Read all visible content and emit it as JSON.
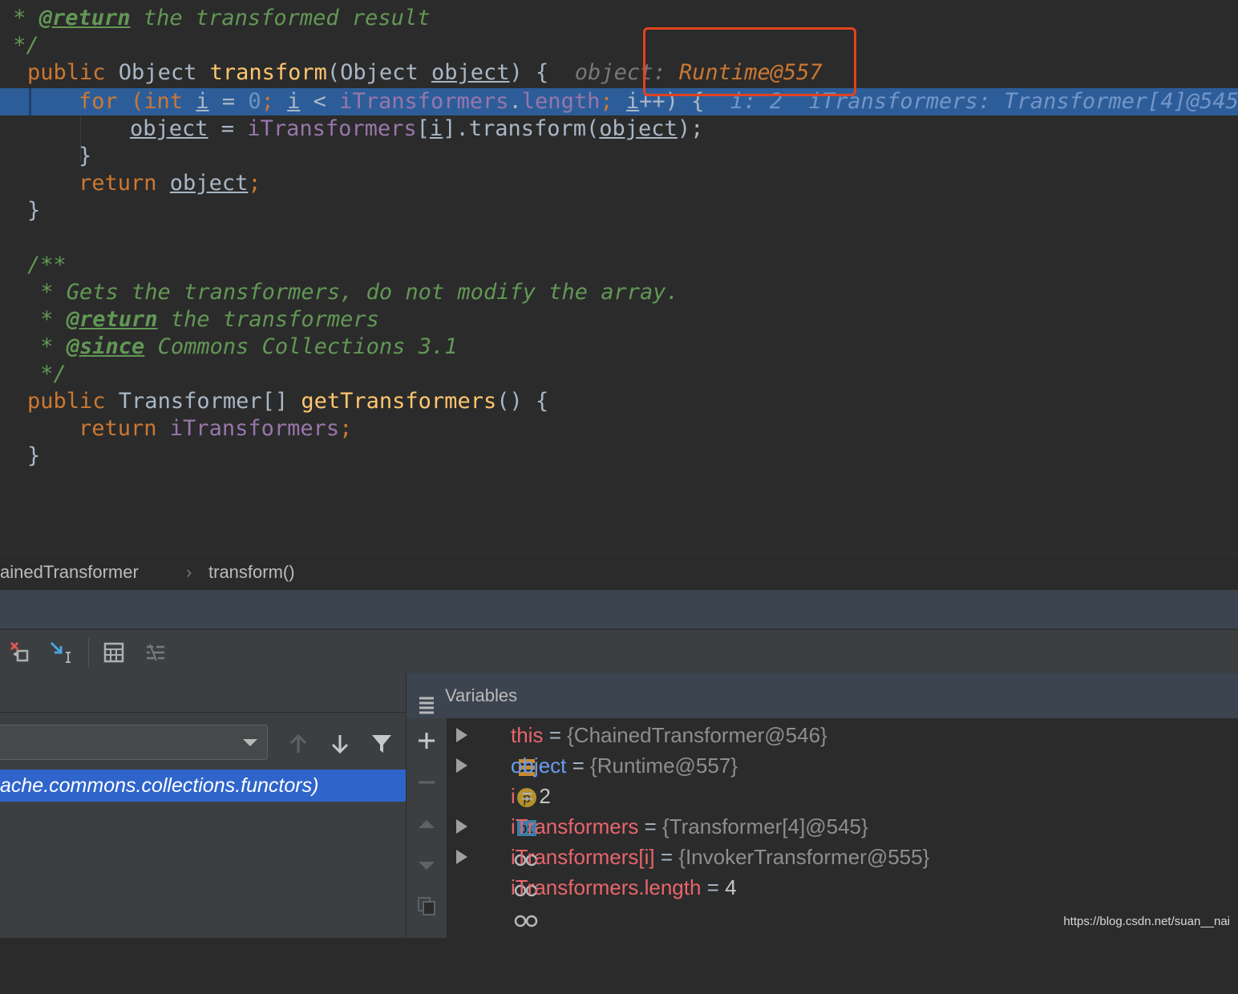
{
  "editor": {
    "line1": {
      "star": " * ",
      "tag": "@return",
      "rest": " the transformed result"
    },
    "line2": " */",
    "line3": {
      "kw": "public ",
      "type": "Object ",
      "fn": "transform",
      "p1": "(Object ",
      "param": "object",
      "p2": ") {",
      "hint_label": "object: ",
      "hint_value": "Runtime@557"
    },
    "line4": {
      "kw": "for ",
      "p1": "(",
      "kw2": "int ",
      "var": "i",
      "p2": " = ",
      "num": "0",
      "semi": "; ",
      "var2": "i",
      "p3": " < ",
      "fld": "iTransformers",
      "dot": ".",
      "fld2": "length",
      "semi2": "; ",
      "var3": "i",
      "p4": "++) {",
      "hint1": "i: 2",
      "hint2": "iTransformers: Transformer[4]@545"
    },
    "line5": {
      "var": "object",
      "p1": " = ",
      "fld": "iTransformers",
      "p2": "[",
      "idx": "i",
      "p3": "].transform(",
      "arg": "object",
      "p4": ");"
    },
    "line6": "}",
    "line7": {
      "kw": "return ",
      "var": "object",
      "semi": ";"
    },
    "line8": "}",
    "line10": "/**",
    "line11": " * Gets the transformers, do not modify the array.",
    "line12": {
      "star": " * ",
      "tag": "@return",
      "rest": " the transformers"
    },
    "line13": {
      "star": " * ",
      "tag": "@since",
      "rest": " Commons Collections 3.1"
    },
    "line14": " */",
    "line15": {
      "kw": "public ",
      "type": "Transformer[] ",
      "fn": "getTransformers",
      "p": "() {"
    },
    "line16": {
      "kw": "return ",
      "fld": "iTransformers",
      "semi": ";"
    },
    "line17": "}"
  },
  "breadcrumb": {
    "class": "ainedTransformer",
    "sep": "›",
    "method": "transform()"
  },
  "frames": {
    "selected": "ache.commons.collections.functors)"
  },
  "variables": {
    "title": "Variables",
    "rows": [
      {
        "name": "this",
        "eq": " = ",
        "value": "{ChainedTransformer@546}",
        "icon": "field-stack-icon",
        "expandable": true
      },
      {
        "name": "object",
        "eq": " = ",
        "value": "{Runtime@557}",
        "icon": "parameter-icon",
        "expandable": true
      },
      {
        "name": "i",
        "eq": " = ",
        "value": "2",
        "icon": "primitive-icon",
        "expandable": false
      },
      {
        "name": "iTransformers",
        "eq": " = ",
        "value": "{Transformer[4]@545}",
        "icon": "watch-icon",
        "expandable": true
      },
      {
        "name": "iTransformers[i]",
        "eq": " = ",
        "value": "{InvokerTransformer@555}",
        "icon": "watch-icon",
        "expandable": true
      },
      {
        "name": "iTransformers.length",
        "eq": " = ",
        "value": "4",
        "icon": "watch-icon",
        "expandable": false
      }
    ]
  },
  "icons": {
    "param_letter": "p",
    "primitive_label": "01"
  },
  "watermark": "https://blog.csdn.net/suan__nai",
  "colors": {
    "highlight": "#2d5d99",
    "frame_selection": "#2f65ca",
    "annotation_box": "#e2421f"
  }
}
